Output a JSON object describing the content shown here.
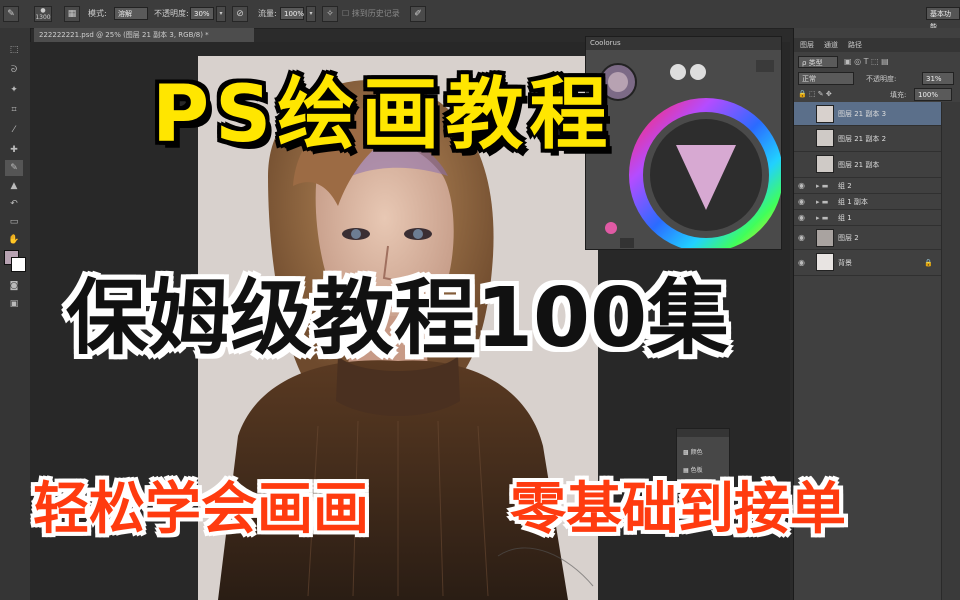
{
  "options_bar": {
    "brush_size": "1300",
    "mode_label": "模式:",
    "mode_value": "溶解",
    "opacity_label": "不透明度:",
    "opacity_value": "30%",
    "flow_label": "流量:",
    "flow_value": "100%",
    "history_label": "抹到历史记录",
    "workspace_value": "基本功能"
  },
  "document": {
    "tab_title": "222222221.psd @ 25% (图层 21 副本 3, RGB/8) *"
  },
  "coolorus": {
    "title": "Coolorus"
  },
  "layers_panel": {
    "tabs": [
      "图层",
      "通道",
      "路径"
    ],
    "filter_label": "类型",
    "blend_mode": "正常",
    "opacity_label": "不透明度:",
    "opacity_value": "31%",
    "fill_label": "填充:",
    "fill_value": "100%",
    "layers": [
      {
        "name": "图层 21 副本 3",
        "selected": true
      },
      {
        "name": "图层 21 副本 2",
        "selected": false
      },
      {
        "name": "图层 21 副本",
        "selected": false
      },
      {
        "name": "组 2",
        "selected": false
      },
      {
        "name": "组 1 副本",
        "selected": false
      },
      {
        "name": "组 1",
        "selected": false
      },
      {
        "name": "图层 2",
        "selected": false
      },
      {
        "name": "背景",
        "selected": false
      }
    ]
  },
  "mini_panel": {
    "items": [
      "颜色",
      "色板"
    ]
  },
  "overlay": {
    "title": "PS绘画教程",
    "subtitle": "保姆级教程100集",
    "tagline_left": "轻松学会画画",
    "tagline_right": "零基础到接单"
  },
  "colors": {
    "title_yellow": "#ffe600",
    "tagline_orange": "#ff3b0f",
    "ps_dark": "#3c3c3c",
    "selected_layer": "#5b6f8a"
  }
}
